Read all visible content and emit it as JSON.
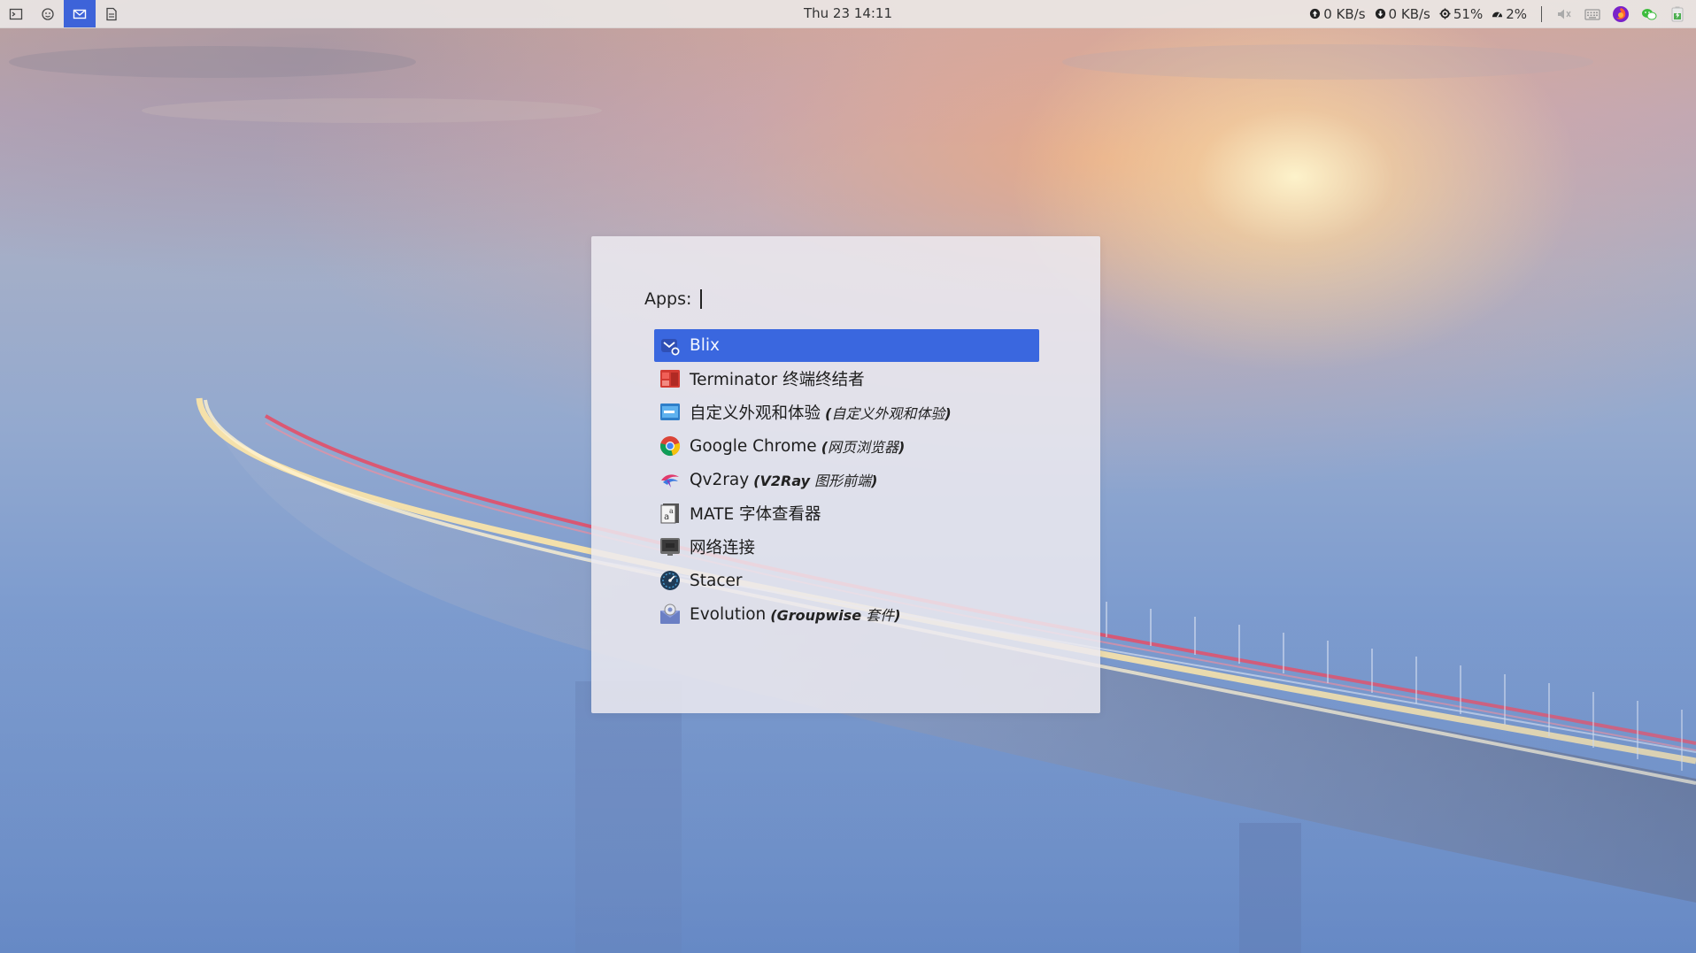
{
  "panel": {
    "workspaces": [
      {
        "icon": "terminal-icon"
      },
      {
        "icon": "settings-face-icon"
      },
      {
        "icon": "mail-icon",
        "active": true
      },
      {
        "icon": "document-icon"
      }
    ],
    "clock": "Thu 23 14:11",
    "stats": [
      {
        "icon": "upload-speed-icon",
        "value": "0 KB/s"
      },
      {
        "icon": "download-speed-icon",
        "value": "0 KB/s"
      },
      {
        "icon": "cpu-icon",
        "value": "51%"
      },
      {
        "icon": "memory-gauge-icon",
        "value": "2%"
      }
    ],
    "tray": [
      "speaker-muted-icon",
      "keyboard-icon",
      "firefox-icon",
      "wechat-icon",
      "battery-icon"
    ]
  },
  "launcher": {
    "prompt_label": "Apps:",
    "query": "",
    "items": [
      {
        "name": "Blix",
        "sub": "",
        "sub_bold": "",
        "icon": "blix-icon",
        "selected": true
      },
      {
        "name": "Terminator 终端终结者",
        "sub": "",
        "sub_bold": "",
        "icon": "terminator-icon"
      },
      {
        "name": "自定义外观和体验",
        "sub": "自定义外观和体验",
        "sub_bold": "",
        "icon": "appearance-icon"
      },
      {
        "name": "Google Chrome",
        "sub": "网页浏览器",
        "sub_bold": "",
        "icon": "chrome-icon"
      },
      {
        "name": "Qv2ray",
        "sub": "图形前端",
        "sub_bold": "V2Ray",
        "icon": "qv2ray-icon"
      },
      {
        "name": "MATE 字体查看器",
        "sub": "",
        "sub_bold": "",
        "icon": "font-viewer-icon"
      },
      {
        "name": "网络连接",
        "sub": "",
        "sub_bold": "",
        "icon": "network-icon"
      },
      {
        "name": "Stacer",
        "sub": "",
        "sub_bold": "",
        "icon": "stacer-icon"
      },
      {
        "name": "Evolution",
        "sub": "套件",
        "sub_bold": "Groupwise",
        "icon": "evolution-icon"
      }
    ]
  },
  "colors": {
    "accent": "#3a67df",
    "panel": "#ece9e8"
  }
}
